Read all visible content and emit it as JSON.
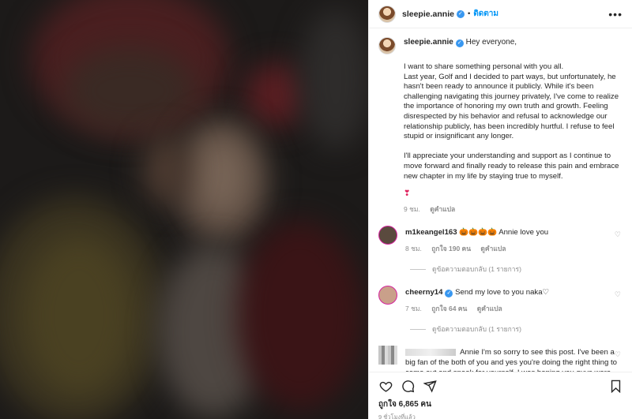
{
  "post": {
    "username": "sleepie.annie",
    "follow_label": "ติดตาม",
    "more_label": "•••"
  },
  "caption": {
    "greeting": "Hey everyone,",
    "body": "I want to share something personal with you all.\nLast year, Golf and I decided to part ways, but unfortunately, he hasn't been ready to announce it publicly. While it's been challenging navigating this journey privately, I've come to realize the importance of honoring my own truth and growth. Feeling disrespected by his behavior and refusal to acknowledge our relationship publicly, has been incredibly hurtful. I refuse to feel stupid or insignificant any longer.\n\nI'll appreciate your understanding and support as I continue to move forward and finally ready to release this pain and embrace new chapter in my life by staying true to myself.",
    "emoji": "❣",
    "time": "9 ชม.",
    "translate": "ดูคำแปล"
  },
  "comments": [
    {
      "username": "m1keangel163",
      "text": "🎃🎃🎃🎃 Annie love you",
      "time": "8 ชม.",
      "likes": "ถูกใจ 190 คน",
      "translate": "ดูคำแปล",
      "replies": "ดูข้อความตอบกลับ (1 รายการ)"
    },
    {
      "username": "cheerny14",
      "text": "Send my love to you naka♡",
      "time": "7 ชม.",
      "likes": "ถูกใจ 64 คน",
      "translate": "ดูคำแปล",
      "replies": "ดูข้อความตอบกลับ (1 รายการ)"
    },
    {
      "text": "Annie I'm so sorry to see this post. I've been a big fan of the both of you and yes you're doing the right thing to come out and speak for yourself. I was hoping you guys were just dealing your own personal things and will be back"
    }
  ],
  "footer": {
    "likes": "ถูกใจ 6,865 คน",
    "time": "9 ชั่วโมงที่แล้ว"
  },
  "colors": {
    "accent": "#0095f6",
    "verified": "#3897f0",
    "muted": "#8e8e8e"
  },
  "icons": [
    "heart-icon",
    "comment-icon",
    "share-icon",
    "bookmark-icon",
    "verified-icon",
    "more-icon"
  ]
}
